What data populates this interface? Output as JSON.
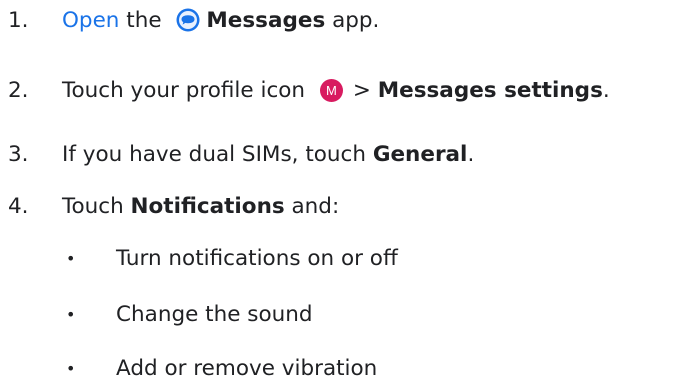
{
  "steps": [
    {
      "num": "1.",
      "link": "Open",
      "pre": " the ",
      "icon": "messages-app-icon",
      "bold": "Messages",
      "post": " app."
    },
    {
      "num": "2.",
      "pre": "Touch your profile icon ",
      "avatar_letter": "M",
      "sep": "> ",
      "bold": "Messages settings",
      "post": "."
    },
    {
      "num": "3.",
      "pre": "If you have dual SIMs, touch ",
      "bold": "General",
      "post": "."
    },
    {
      "num": "4.",
      "pre": "Touch ",
      "bold": "Notifications",
      "post": " and:"
    }
  ],
  "bullets": [
    "Turn notifications on or off",
    "Change the sound",
    "Add or remove vibration"
  ],
  "bullet_symbol": "•",
  "colors": {
    "link": "#1a73e8",
    "messages_icon": "#1a73e8",
    "avatar": "#d81b60",
    "text": "#202124"
  }
}
